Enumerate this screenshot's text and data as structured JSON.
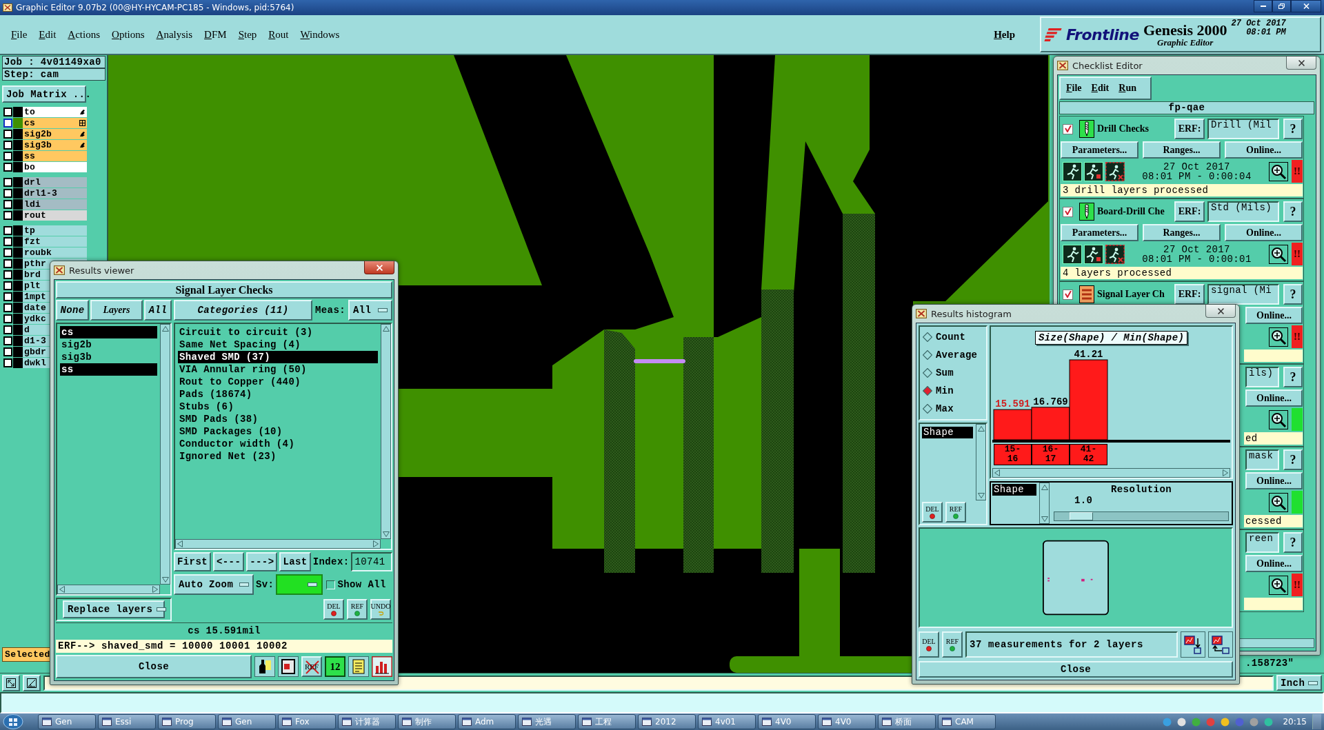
{
  "window": {
    "title": "Graphic Editor 9.07b2 (00@HY-HYCAM-PC185 - Windows, pid:5764)"
  },
  "menu": {
    "items": [
      "File",
      "Edit",
      "Actions",
      "Options",
      "Analysis",
      "DFM",
      "Step",
      "Rout",
      "Windows"
    ],
    "help": "Help"
  },
  "brand": {
    "logo": "Frontline",
    "product": "Genesis 2000",
    "module": "Graphic Editor",
    "date": "27 Oct 2017",
    "time": "08:01 PM"
  },
  "job_panel": {
    "job": "Job : 4v01149xa0",
    "step": "Step: cam",
    "matrix_button": "Job Matrix ...",
    "layer_groups": [
      [
        {
          "name": "to",
          "kind": "edit",
          "color": "#ffffff",
          "checked": false,
          "displayed": false
        },
        {
          "name": "cs",
          "kind": "board",
          "color": "#ffc860",
          "checked": false,
          "displayed": true
        },
        {
          "name": "sig2b",
          "kind": "edit",
          "color": "#ffc860",
          "checked": false,
          "displayed": false
        },
        {
          "name": "sig3b",
          "kind": "edit",
          "color": "#ffc860",
          "checked": false,
          "displayed": false
        },
        {
          "name": "ss",
          "kind": "plain",
          "color": "#ffc860",
          "checked": false,
          "displayed": false
        },
        {
          "name": "bo",
          "kind": "plain",
          "color": "#ffffff",
          "checked": false,
          "displayed": false
        }
      ],
      [
        {
          "name": "drl",
          "kind": "plain",
          "color": "#a4bcc4",
          "checked": false,
          "displayed": false
        },
        {
          "name": "drl1-3",
          "kind": "plain",
          "color": "#a4bcc4",
          "checked": false,
          "displayed": false
        },
        {
          "name": "ldi",
          "kind": "plain",
          "color": "#a4bcc4",
          "checked": false,
          "displayed": false
        },
        {
          "name": "rout",
          "kind": "plain",
          "color": "#d8d8d8",
          "checked": false,
          "displayed": false
        }
      ],
      [
        {
          "name": "tp",
          "kind": "plain",
          "color": "#a0dcdc",
          "checked": false,
          "displayed": false
        },
        {
          "name": "fzt",
          "kind": "plain",
          "color": "#a0dcdc",
          "checked": false,
          "displayed": false
        },
        {
          "name": "roubk",
          "kind": "plain",
          "color": "#a0dcdc",
          "checked": false,
          "displayed": false
        },
        {
          "name": "pthr",
          "kind": "plain",
          "color": "#a0dcdc",
          "checked": false,
          "displayed": false
        },
        {
          "name": "brd",
          "kind": "plain",
          "color": "#a0dcdc",
          "checked": false,
          "displayed": false
        },
        {
          "name": "plt",
          "kind": "plain",
          "color": "#a0dcdc",
          "checked": false,
          "displayed": false
        },
        {
          "name": "1mpt",
          "kind": "plain",
          "color": "#a0dcdc",
          "checked": false,
          "displayed": false
        },
        {
          "name": "date",
          "kind": "plain",
          "color": "#a0dcdc",
          "checked": false,
          "displayed": false
        },
        {
          "name": "ydkc",
          "kind": "plain",
          "color": "#a0dcdc",
          "checked": false,
          "displayed": false
        },
        {
          "name": "d",
          "kind": "plain",
          "color": "#a0dcdc",
          "checked": false,
          "displayed": false
        },
        {
          "name": "d1-3",
          "kind": "plain",
          "color": "#a0dcdc",
          "checked": false,
          "displayed": false
        },
        {
          "name": "gbdr",
          "kind": "plain",
          "color": "#a0dcdc",
          "checked": false,
          "displayed": false
        },
        {
          "name": "dwkl",
          "kind": "plain",
          "color": "#a0dcdc",
          "checked": false,
          "displayed": false
        }
      ]
    ],
    "selected_label": "Selected"
  },
  "right_panel": {
    "readout": ".158723\""
  },
  "status_bar": {
    "unit": "Inch"
  },
  "taskbar": {
    "items": [
      "Gen",
      "Essi",
      "Prog",
      "Gen",
      "Fox",
      "计算器",
      "制作",
      "Adm",
      "光遇",
      "工程",
      "2012",
      "4v01",
      "4V0",
      "4V0",
      "桥面",
      "CAM"
    ],
    "clock": "20:15"
  },
  "checklist": {
    "title": "Checklist Editor",
    "menu": [
      "File",
      "Edit",
      "Run"
    ],
    "name": "fp-qae",
    "checks": [
      {
        "kind": "drill",
        "checked": true,
        "name": "Drill Checks",
        "erf_button": "ERF:",
        "erf": "Drill (Mil",
        "help": "?",
        "buttons": [
          "Parameters...",
          "Ranges...",
          "Online..."
        ],
        "date": "27 Oct 2017",
        "time": "08:01 PM - 0:00:04",
        "passed": false,
        "status_text": "!!",
        "message": "3 drill layers processed"
      },
      {
        "kind": "drill",
        "checked": true,
        "name": "Board-Drill Che",
        "erf_button": "ERF:",
        "erf": "Std (Mils)",
        "help": "?",
        "buttons": [
          "Parameters...",
          "Ranges...",
          "Online..."
        ],
        "date": "27 Oct 2017",
        "time": "08:01 PM - 0:00:01",
        "passed": false,
        "status_text": "!!",
        "message": "4 layers processed"
      },
      {
        "kind": "signal",
        "checked": true,
        "name": "Signal Layer Ch",
        "erf_button": "ERF:",
        "erf": "signal (Mi",
        "help": "?",
        "buttons": [
          "Online..."
        ],
        "passed": false,
        "status_text": "!!"
      },
      {
        "kind": "covered",
        "erf": "ils)",
        "help": "?",
        "buttons": [
          "Online..."
        ],
        "passed": true,
        "message": "ed"
      },
      {
        "kind": "covered",
        "erf": "mask",
        "help": "?",
        "buttons": [
          "Online..."
        ],
        "passed": true,
        "message": "cessed"
      },
      {
        "kind": "covered",
        "erf": "reen",
        "help": "?",
        "buttons": [
          "Online..."
        ],
        "passed": false,
        "status_text": "!!"
      }
    ]
  },
  "histogram": {
    "title": "Results histogram",
    "modes": [
      {
        "label": "Count",
        "selected": false
      },
      {
        "label": "Average",
        "selected": false
      },
      {
        "label": "Sum",
        "selected": false
      },
      {
        "label": "Min",
        "selected": true
      },
      {
        "label": "Max",
        "selected": false
      }
    ],
    "fields": [
      {
        "label": "Shape",
        "selected": true
      }
    ],
    "list_tools": [
      {
        "kind": "delete",
        "label": "DEL"
      },
      {
        "kind": "refresh",
        "label": "REF"
      }
    ],
    "chart_data": {
      "type": "bar",
      "title": "Size(Shape) / Min(Shape)",
      "categories": [
        "15-16",
        "16-17",
        "41-42"
      ],
      "values": [
        15.591,
        16.769,
        41.21
      ],
      "data_labels": true
    },
    "bins": [
      {
        "selected": true
      },
      {
        "selected": false
      },
      {
        "selected": false
      }
    ],
    "group_fields": [
      {
        "label": "Shape",
        "selected": true
      }
    ],
    "resolution": {
      "label": "Resolution",
      "value": "1.0",
      "level": 0.1
    },
    "footer_tools": [
      {
        "kind": "delete",
        "label": "DEL"
      },
      {
        "kind": "refresh",
        "label": "REF"
      }
    ],
    "summary": "37 measurements for 2 layers",
    "close": "Close"
  },
  "results_viewer": {
    "title": "Results viewer",
    "header": "Signal Layer Checks",
    "none_button": "None",
    "layers_button": "Layers",
    "all_button": "All",
    "categories_button": "Categories (11)",
    "meas_label": "Meas:",
    "meas_value": "All",
    "layers": [
      {
        "name": "cs",
        "selected": true
      },
      {
        "name": "sig2b",
        "selected": false
      },
      {
        "name": "sig3b",
        "selected": false
      },
      {
        "name": "ss",
        "selected": true
      }
    ],
    "categories": [
      {
        "label": "Circuit to circuit (3)",
        "selected": false
      },
      {
        "label": "Same Net Spacing (4)",
        "selected": false
      },
      {
        "label": "Shaved SMD (37)",
        "selected": true
      },
      {
        "label": "VIA Annular ring (50)",
        "selected": false
      },
      {
        "label": "Rout to Copper (440)",
        "selected": false
      },
      {
        "label": "Pads (18674)",
        "selected": false
      },
      {
        "label": "Stubs (6)",
        "selected": false
      },
      {
        "label": "SMD Pads (38)",
        "selected": false
      },
      {
        "label": "SMD Packages (10)",
        "selected": false
      },
      {
        "label": "Conductor width (4)",
        "selected": false
      },
      {
        "label": "Ignored Net (23)",
        "selected": false
      }
    ],
    "nav_buttons": [
      "First",
      "<---",
      "--->",
      "Last"
    ],
    "index_label": "Index:",
    "index_value": "10741",
    "zoom_mode": "Auto Zoom",
    "sv_label": "Sv:",
    "show_all": {
      "label": "Show All",
      "checked": false
    },
    "replace_mode": "Replace layers",
    "tools": [
      {
        "kind": "delete",
        "label": "DEL"
      },
      {
        "kind": "refresh",
        "label": "REF"
      },
      {
        "kind": "undo",
        "label": "UNDO"
      }
    ],
    "measurement": "cs 15.591mil",
    "erf_line": "ERF--> shaved_smd = 10000 10001 10002",
    "close": "Close",
    "toolbar": [
      {
        "kind": "figure"
      },
      {
        "kind": "marker"
      },
      {
        "kind": "ref",
        "text": "REF"
      },
      {
        "kind": "count",
        "text": "12"
      },
      {
        "kind": "notes"
      },
      {
        "kind": "chart"
      }
    ]
  }
}
